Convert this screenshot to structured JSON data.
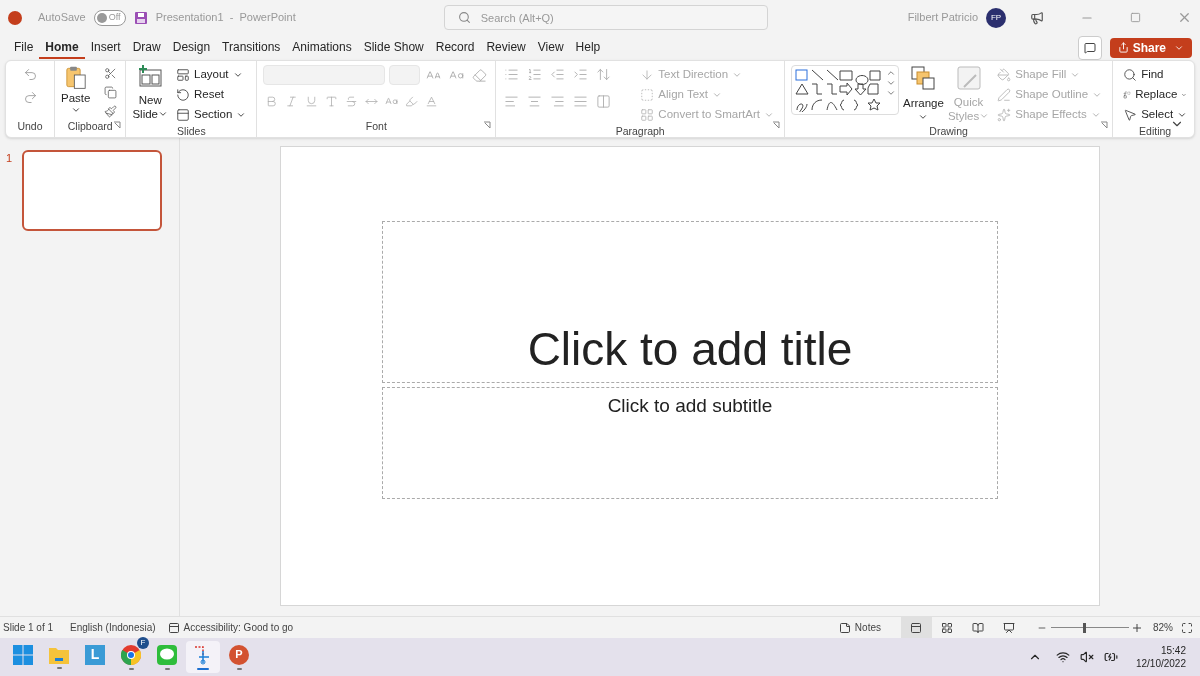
{
  "title_bar": {
    "autosave": {
      "label": "AutoSave",
      "on": false,
      "state": "Off"
    },
    "document_title": "Presentation1  -  PowerPoint",
    "search": {
      "placeholder": "Search (Alt+Q)"
    },
    "user_name": "Filbert Patricio",
    "avatar": "FP"
  },
  "menu_tabs": [
    {
      "label": "File",
      "selected": false
    },
    {
      "label": "Home",
      "selected": true
    },
    {
      "label": "Insert",
      "selected": false
    },
    {
      "label": "Draw",
      "selected": false
    },
    {
      "label": "Design",
      "selected": false
    },
    {
      "label": "Transitions",
      "selected": false
    },
    {
      "label": "Animations",
      "selected": false
    },
    {
      "label": "Slide Show",
      "selected": false
    },
    {
      "label": "Record",
      "selected": false
    },
    {
      "label": "Review",
      "selected": false
    },
    {
      "label": "View",
      "selected": false
    },
    {
      "label": "Help",
      "selected": false
    }
  ],
  "share_button": "Share",
  "ribbon": {
    "groups": [
      {
        "label": "Undo"
      },
      {
        "label": "Clipboard",
        "items": [
          {
            "label": "Paste",
            "disabled": false
          }
        ]
      },
      {
        "label": "Slides",
        "items": [
          {
            "label": "New",
            "disabled": false
          },
          {
            "label": "Slide",
            "disabled": false
          },
          {
            "label": "Layout",
            "disabled": false
          },
          {
            "label": "Reset",
            "disabled": false
          },
          {
            "label": "Section",
            "disabled": false
          }
        ]
      },
      {
        "label": "Font"
      },
      {
        "label": "Paragraph",
        "items": [
          {
            "label": "Text Direction",
            "disabled": true
          },
          {
            "label": "Align Text",
            "disabled": true
          },
          {
            "label": "Convert to SmartArt",
            "disabled": true
          }
        ]
      },
      {
        "label": "Drawing",
        "items": [
          {
            "label": "Arrange",
            "disabled": false
          },
          {
            "label": "Quick",
            "disabled": true
          },
          {
            "label": "Styles",
            "disabled": true
          },
          {
            "label": "Shape Fill",
            "disabled": true
          },
          {
            "label": "Shape Outline",
            "disabled": true
          },
          {
            "label": "Shape Effects",
            "disabled": true
          }
        ]
      },
      {
        "label": "Editing",
        "items": [
          {
            "label": "Find",
            "disabled": false
          },
          {
            "label": "Replace",
            "disabled": false
          },
          {
            "label": "Select",
            "disabled": false
          }
        ]
      }
    ]
  },
  "slides": [
    {
      "number": "1",
      "selected": true
    }
  ],
  "slide": {
    "title_placeholder": "Click to add title",
    "subtitle_placeholder": "Click to add subtitle"
  },
  "status_bar": {
    "slide_count": "Slide 1 of 1",
    "language": "English (Indonesia)",
    "accessibility": "Accessibility: Good to go",
    "notes": "Notes",
    "views": [
      {
        "selected": true
      },
      {
        "selected": false
      },
      {
        "selected": false
      },
      {
        "selected": false
      }
    ],
    "zoom": {
      "level": 0.42,
      "reading": "82%"
    }
  },
  "taskbar": {
    "apps": [
      {
        "kind": "start",
        "selected": false,
        "running": false
      },
      {
        "kind": "files",
        "selected": false,
        "running": true
      },
      {
        "kind": "launcher",
        "selected": false,
        "running": false,
        "letter": "L"
      },
      {
        "kind": "browser",
        "selected": false,
        "running": true,
        "badge": "F"
      },
      {
        "kind": "chat",
        "selected": false,
        "running": true
      },
      {
        "kind": "snip",
        "selected": true,
        "running": true
      },
      {
        "kind": "slides",
        "selected": false,
        "running": true,
        "letter": "P"
      }
    ],
    "time": "15:42",
    "date": "12/10/2022"
  }
}
